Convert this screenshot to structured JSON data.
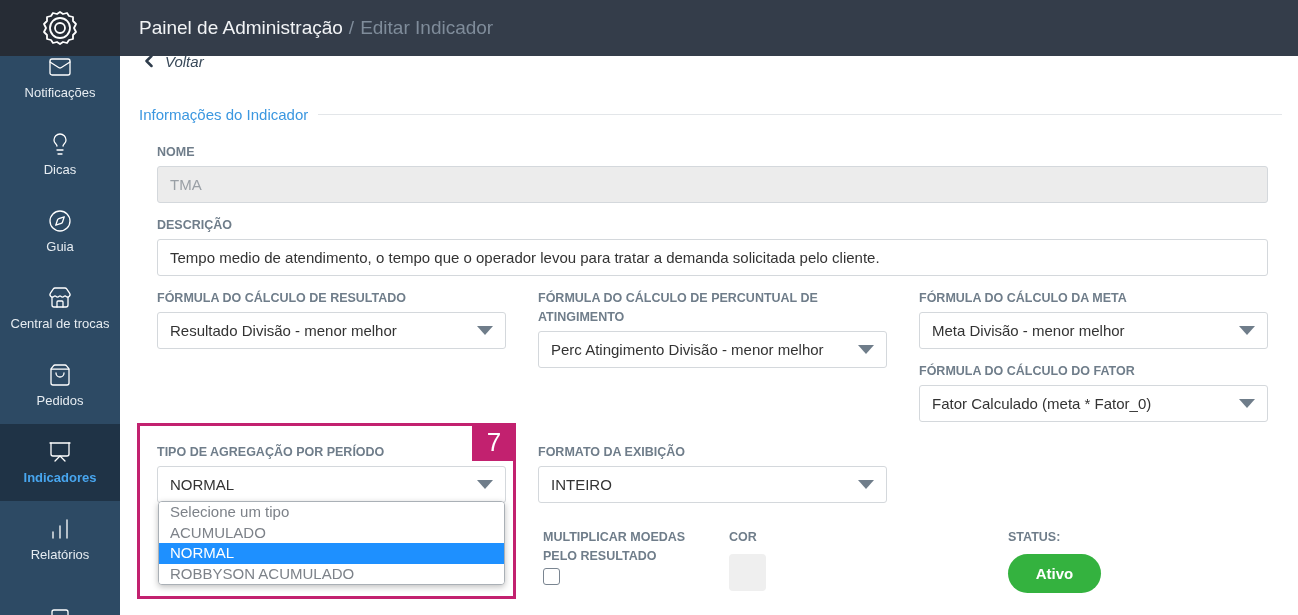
{
  "header": {
    "title": "Painel de Administração",
    "separator": "/",
    "subtitle": "Editar Indicador"
  },
  "sidebar": {
    "items": [
      {
        "label": "Notificações",
        "selected": false
      },
      {
        "label": "Dicas",
        "selected": false
      },
      {
        "label": "Guia",
        "selected": false
      },
      {
        "label": "Central de trocas",
        "selected": false
      },
      {
        "label": "Pedidos",
        "selected": false
      },
      {
        "label": "Indicadores",
        "selected": true
      },
      {
        "label": "Relatórios",
        "selected": false
      },
      {
        "selected": false
      }
    ]
  },
  "back_link": "Voltar",
  "section_title": "Informações do Indicador",
  "nome": {
    "label": "NOME",
    "value": "TMA",
    "disabled": true
  },
  "descricao": {
    "label": "DESCRIÇÃO",
    "value": "Tempo medio de atendimento, o tempo que o operador levou para tratar a demanda solicitada pelo cliente."
  },
  "formula_resultado": {
    "label": "FÓRMULA DO CÁLCULO DE RESULTADO",
    "value": "Resultado Divisão - menor melhor"
  },
  "formula_percentual": {
    "label": "FÓRMULA DO CÁLCULO DE PERCUNTUAL DE ATINGIMENTO",
    "value": "Perc Atingimento Divisão - menor melhor"
  },
  "formula_meta": {
    "label": "FÓRMULA DO CÁLCULO DA META",
    "value": "Meta Divisão - menor melhor"
  },
  "formula_fator": {
    "label": "FÓRMULA DO CÁLCULO DO FATOR",
    "value": "Fator Calculado (meta * Fator_0)"
  },
  "tipo_agregacao": {
    "label": "TIPO DE AGREGAÇÃO POR PERÍODO",
    "value": "NORMAL",
    "expanded": true,
    "options": [
      {
        "label": "Selecione um tipo",
        "selected": false
      },
      {
        "label": "ACUMULADO",
        "selected": false
      },
      {
        "label": "NORMAL",
        "selected": true
      },
      {
        "label": "ROBBYSON ACUMULADO",
        "selected": false
      }
    ]
  },
  "formato_exibicao": {
    "label": "FORMATO DA EXIBIÇÃO",
    "value": "INTEIRO"
  },
  "multiplicar_moedas": {
    "label": "MULTIPLICAR MOEDAS PELO RESULTADO",
    "checked": false
  },
  "cor": {
    "label": "COR"
  },
  "status": {
    "label": "STATUS:",
    "value": "Ativo",
    "on": true
  },
  "annotation": {
    "label": "7"
  }
}
